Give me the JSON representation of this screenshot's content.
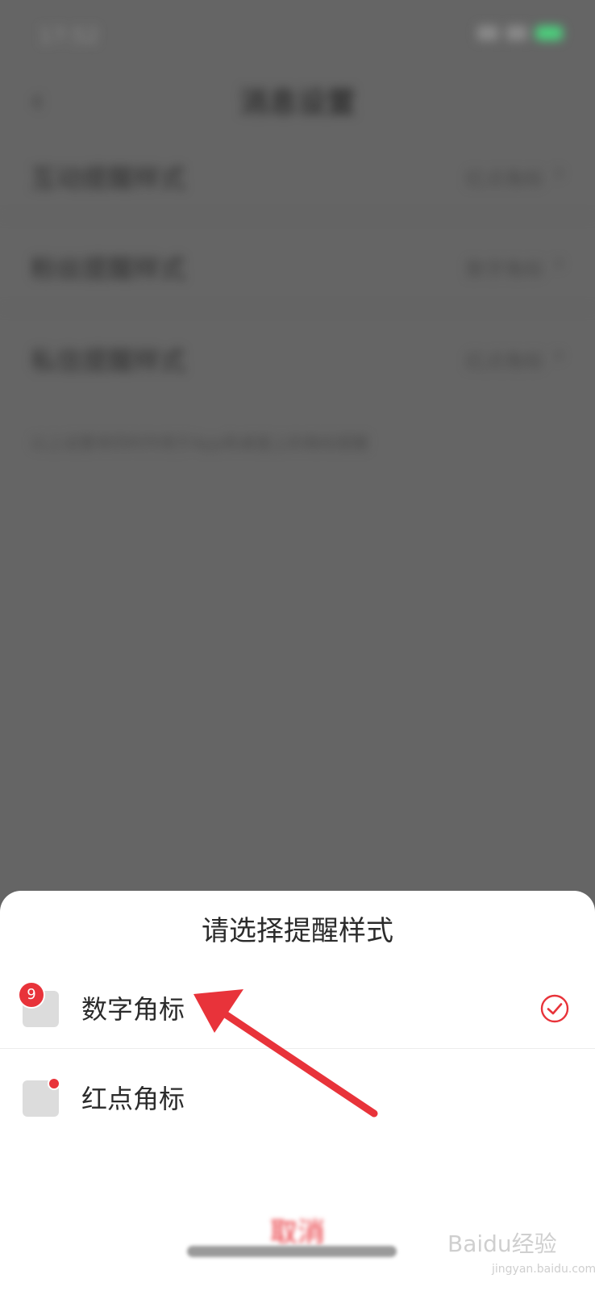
{
  "background": {
    "status_time": "17:52",
    "nav_title": "消息设置",
    "settings": [
      {
        "label": "互动提醒样式",
        "value": "红点角标"
      },
      {
        "label": "粉丝提醒样式",
        "value": "数字角标"
      },
      {
        "label": "私信提醒样式",
        "value": "红点角标"
      }
    ],
    "hint": "以上设置将同时作用于App和桌面上的角标提醒"
  },
  "sheet": {
    "title": "请选择提醒样式",
    "options": [
      {
        "label": "数字角标",
        "badge": "9",
        "selected": true
      },
      {
        "label": "红点角标",
        "badge": "",
        "selected": false
      }
    ],
    "cancel_label": "取消"
  },
  "colors": {
    "accent": "#e8333a",
    "overlay": "#656565",
    "sheet_bg": "#ffffff"
  },
  "watermark": {
    "brand": "Baidu经验",
    "url": "jingyan.baidu.com"
  }
}
